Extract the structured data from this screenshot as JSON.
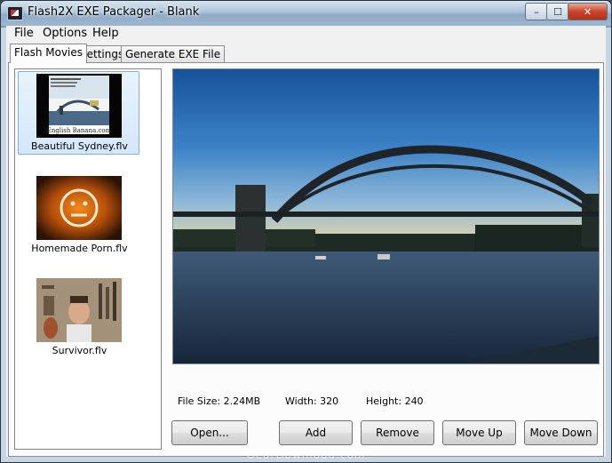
{
  "window": {
    "title": "Flash2X EXE Packager - Blank",
    "minimize_glyph": "–",
    "maximize_glyph": "☐",
    "close_glyph": "✕"
  },
  "menu": {
    "items": [
      {
        "label": "File"
      },
      {
        "label": "Options"
      },
      {
        "label": "Help"
      }
    ]
  },
  "tabs": [
    {
      "label": "Flash Movies",
      "active": true
    },
    {
      "label": "Settings",
      "active": false
    },
    {
      "label": "Generate EXE File",
      "active": false
    }
  ],
  "movies": [
    {
      "label": "Beautiful Sydney.flv",
      "selected": true,
      "thumb_text_1": "English Banana.com"
    },
    {
      "label": "Homemade Porn.flv",
      "selected": false
    },
    {
      "label": "Survivor.flv",
      "selected": false
    }
  ],
  "file_info": {
    "size": "File Size: 2.24MB",
    "width": "Width: 320",
    "height": "Height: 240"
  },
  "buttons": {
    "open": "Open...",
    "add": "Add",
    "remove": "Remove",
    "move_up": "Move Up",
    "move_down": "Move Down"
  },
  "watermark": "GearDownload.com",
  "colors": {
    "selection": "#d3e8fb",
    "selection_border": "#84acdd",
    "close_button": "#c9452c"
  }
}
